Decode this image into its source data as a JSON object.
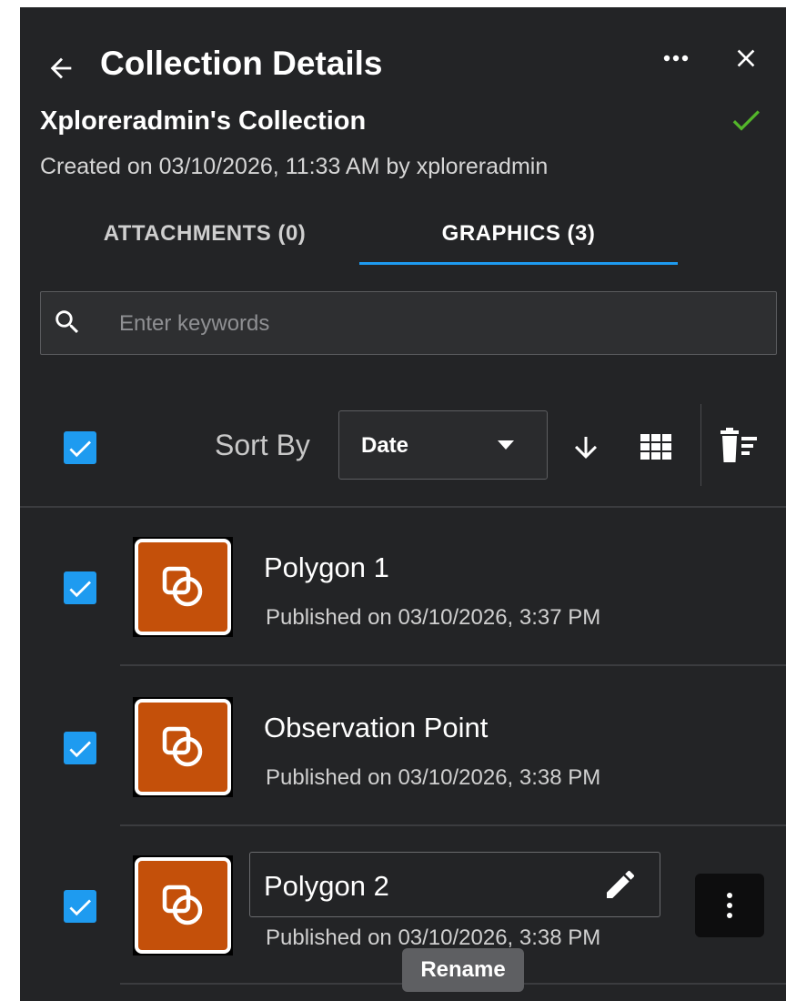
{
  "header": {
    "title": "Collection Details",
    "back_icon": "arrow-left-icon",
    "more_icon": "more-horizontal-icon",
    "close_icon": "close-icon"
  },
  "collection": {
    "name": "Xploreradmin's Collection",
    "created": "Created on 03/10/2026, 11:33 AM by xploreradmin",
    "status_icon": "check-icon",
    "status_color": "#53b52a"
  },
  "tabs": [
    {
      "label": "ATTACHMENTS (0)",
      "active": false
    },
    {
      "label": "GRAPHICS (3)",
      "active": true
    }
  ],
  "search": {
    "placeholder": "Enter keywords",
    "value": ""
  },
  "toolbar": {
    "select_all_checked": true,
    "sort_label": "Sort By",
    "sort_value": "Date",
    "sort_direction_icon": "arrow-down-icon",
    "view_icon": "grid-view-icon",
    "delete_icon": "delete-list-icon"
  },
  "items": [
    {
      "name": "Polygon 1",
      "date": "Published on 03/10/2026, 3:37 PM",
      "checked": true,
      "icon": "graphic-shapes-icon"
    },
    {
      "name": "Observation Point",
      "date": "Published on 03/10/2026, 3:38 PM",
      "checked": true,
      "icon": "graphic-shapes-icon"
    },
    {
      "name": "Polygon 2",
      "date": "Published on 03/10/2026, 3:38 PM",
      "checked": true,
      "icon": "graphic-shapes-icon",
      "rename_icon": "pencil-icon",
      "menu_icon": "more-vertical-icon"
    }
  ],
  "tooltip": {
    "text": "Rename"
  },
  "colors": {
    "panel_bg": "#232426",
    "accent": "#1e9bf0",
    "thumb_bg": "#c4500a"
  }
}
